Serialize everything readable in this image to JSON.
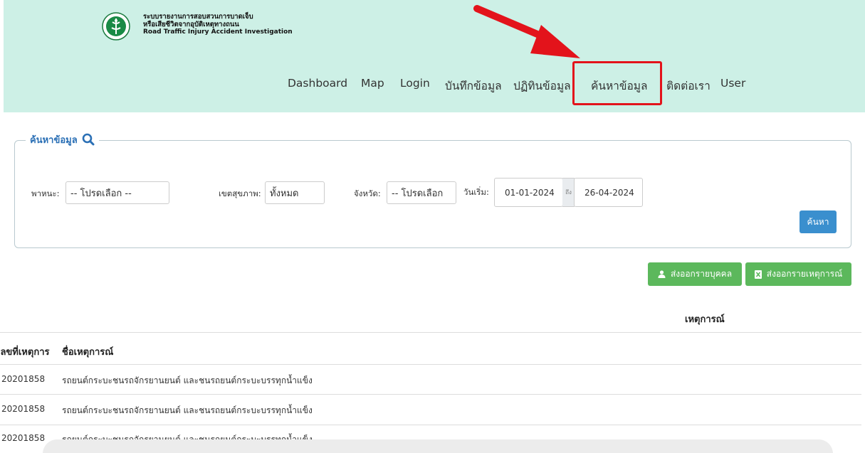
{
  "header": {
    "title_th_line1": "ระบบรายงานการสอบสวนการบาดเจ็บ",
    "title_th_line2": "หรือเสียชีวิตจากอุบัติเหตุทางถนน",
    "title_en": "Road Traffic Injury Accident Investigation",
    "logo_icon": "ministry-of-public-health-seal"
  },
  "nav": {
    "items": [
      "Dashboard",
      "Map",
      "Login",
      "บันทึกข้อมูล",
      "ปฏิทินข้อมูล",
      "ค้นหาข้อมูล",
      "ติดต่อเรา",
      "User"
    ],
    "highlighted": "ค้นหาข้อมูล"
  },
  "search": {
    "legend": "ค้นหาข้อมูล",
    "legend_icon": "search-icon",
    "vehicle_label": "พาหนะ:",
    "vehicle_value": "-- โปรดเลือก --",
    "region_label": "เขตสุขภาพ:",
    "region_value": "ทั้งหมด",
    "province_label": "จังหวัด:",
    "province_value": "-- โปรดเลือก",
    "start_label": "วันเริ่ม:",
    "start_date": "01-01-2024",
    "to_label": "ถึง",
    "end_date": "26-04-2024",
    "button": "ค้นหา"
  },
  "export": {
    "person_label": "ส่งออกรายบุคคล",
    "person_icon": "user-icon",
    "event_label": "ส่งออกรายเหตุการณ์",
    "event_icon": "excel-file-icon"
  },
  "table": {
    "title": "เหตุการณ์",
    "columns": [
      "เลขที่เหตุการ",
      "ชื่อเหตุการณ์"
    ],
    "rows": [
      [
        "20201858",
        "รถยนต์กระบะชนรถจักรยานยนต์ และชนรถยนต์กระบะบรรทุกน้ำแข็ง"
      ],
      [
        "20201858",
        "รถยนต์กระบะชนรถจักรยานยนต์ และชนรถยนต์กระบะบรรทุกน้ำแข็ง"
      ],
      [
        "20201858",
        "รถยนต์กระบะชนรถจักรยานยนต์ และชนรถยนต์กระบะบรรทุกน้ำแข็ง"
      ]
    ]
  },
  "colors": {
    "header_bg": "#cdf0e6",
    "accent_blue": "#3a8fce",
    "export_green": "#5cb85c",
    "highlight_red": "#e3131b"
  }
}
